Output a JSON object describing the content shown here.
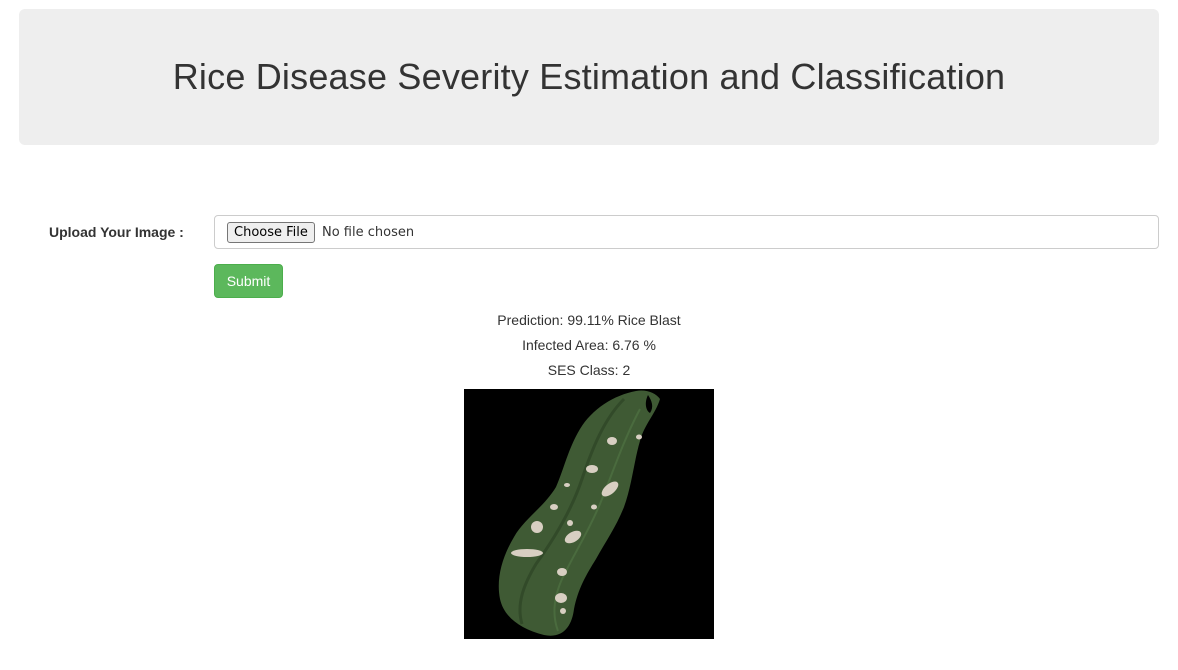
{
  "header": {
    "title": "Rice Disease Severity Estimation and Classification"
  },
  "form": {
    "upload_label": "Upload Your Image :",
    "choose_file_label": "Choose File",
    "no_file_text": "No file chosen",
    "submit_label": "Submit"
  },
  "result": {
    "prediction": "Prediction: 99.11% Rice Blast",
    "infected_area": "Infected Area: 6.76 %",
    "ses_class": "SES Class: 2"
  },
  "colors": {
    "jumbotron_bg": "#eeeeee",
    "submit_bg": "#5cb85c",
    "leaf_green": "#3f5a34",
    "lesion": "#d8cfc2"
  }
}
